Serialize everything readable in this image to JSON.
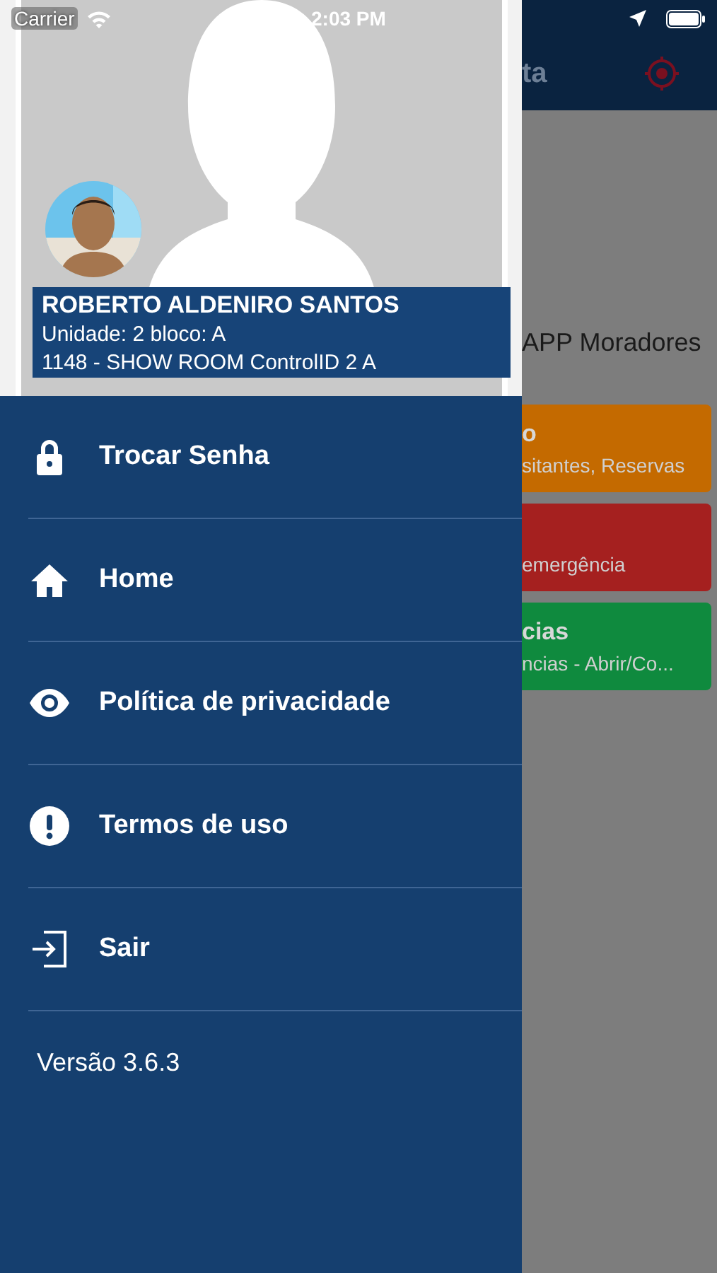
{
  "status_bar": {
    "carrier": "Carrier",
    "time": "2:03 PM"
  },
  "background_screen": {
    "title": "ta",
    "subtitle": "APP Moradores",
    "cards": [
      {
        "title": "o",
        "subtitle": "sitantes, Reservas",
        "color": "#c46a00"
      },
      {
        "subtitle": "emergência",
        "color": "#a5201f"
      },
      {
        "title": "cias",
        "subtitle": "ncias - Abrir/Co...",
        "color": "#0f8a3e"
      }
    ]
  },
  "drawer": {
    "profile": {
      "name": "ROBERTO ALDENIRO SANTOS",
      "unit": "Unidade: 2 bloco: A",
      "location": "1148 - SHOW ROOM ControlID 2 A"
    },
    "menu": [
      {
        "kind": "lock",
        "label": "Trocar Senha"
      },
      {
        "kind": "home",
        "label": "Home"
      },
      {
        "kind": "eye",
        "label": "Política de privacidade"
      },
      {
        "kind": "alert",
        "label": "Termos de uso"
      },
      {
        "kind": "exit",
        "label": "Sair"
      }
    ],
    "version": "Versão 3.6.3"
  }
}
